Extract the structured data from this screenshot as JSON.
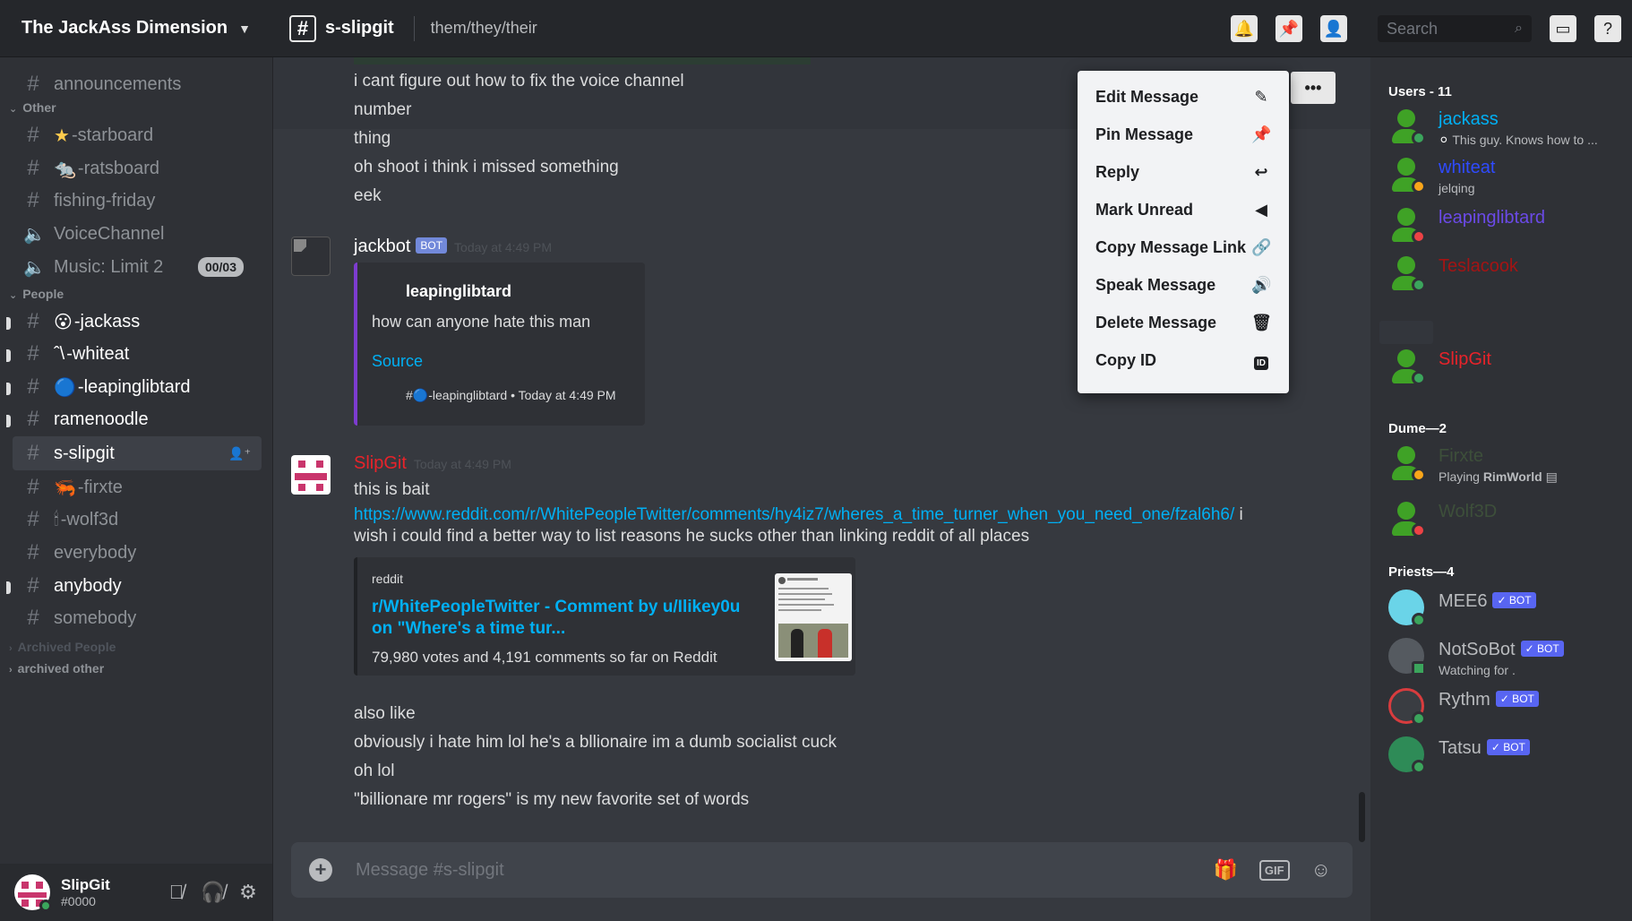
{
  "server": {
    "name": "The JackAss Dimension"
  },
  "channel": {
    "name": "s-slipgit",
    "topic": "them/they/their"
  },
  "search": {
    "placeholder": "Search"
  },
  "colors": {
    "online": "#3ba55c",
    "idle": "#faa61a",
    "dnd": "#ed4245",
    "link": "#00b0f4",
    "bot_tag": "#7289da",
    "embed_border": "#7d3cd0"
  },
  "sidebar": {
    "categories": {
      "other": "Other",
      "people": "People",
      "archived_people": "Archived People",
      "archived_other": "archived other"
    },
    "channels": [
      {
        "label": "announcements"
      },
      {
        "emoji": "★",
        "label": "-starboard"
      },
      {
        "emoji": "🐀",
        "label": "-ratsboard"
      },
      {
        "label": "fishing-friday"
      },
      {
        "label": "VoiceChannel"
      },
      {
        "label": "Music: Limit 2",
        "badge": "00/03"
      },
      {
        "emoji": "😮",
        "label": "-jackass"
      },
      {
        "emoji": "ˆ\\",
        "label": "-whiteat"
      },
      {
        "emoji": "🔵",
        "label": "-leapinglibtard"
      },
      {
        "label": "ramenoodle"
      },
      {
        "label": "s-slipgit"
      },
      {
        "emoji": "🦐",
        "label": "-firxte"
      },
      {
        "emoji": "🕯",
        "label": "-wolf3d"
      },
      {
        "label": "everybody"
      },
      {
        "label": "anybody"
      },
      {
        "label": "somebody"
      }
    ]
  },
  "user_panel": {
    "name": "SlipGit",
    "tag": "#0000"
  },
  "messages": {
    "continuation": [
      "i cant figure out how to fix the voice channel",
      "number",
      "thing",
      "oh shoot i think i missed something",
      "eek"
    ],
    "jackbot": {
      "author": "jackbot",
      "bot_label": "BOT",
      "time": "Today at 4:49 PM",
      "embed": {
        "author": "leapinglibtard",
        "text": "how can anyone hate this man",
        "source_label": "Source",
        "footer_prefix": "#",
        "footer": "-leapinglibtard • Today at 4:49 PM"
      }
    },
    "slipgit": {
      "author": "SlipGit",
      "time": "Today at 4:49 PM",
      "line1": "this is bait",
      "link": "https://www.reddit.com/r/WhitePeopleTwitter/comments/hy4iz7/wheres_a_time_turner_when_you_need_one/fzal6h6/",
      "line2_suffix": " i",
      "line3": "wish i could find a better way to list reasons he sucks other than linking reddit of all places",
      "embed": {
        "provider": "reddit",
        "title": "r/WhitePeopleTwitter - Comment by u/Ilikey0u on \"Where's a time tur...",
        "description": "79,980 votes and 4,191 comments so far on Reddit"
      },
      "after": [
        "also like",
        "obviously i hate him lol he's a bllionaire im a dumb socialist cuck",
        "oh lol",
        "\"billionare mr rogers\" is my new favorite set of words"
      ]
    }
  },
  "composer": {
    "placeholder": "Message #s-slipgit",
    "gif_label": "GIF"
  },
  "context_menu": {
    "items": [
      {
        "label": "Edit Message",
        "icon": "pencil-icon"
      },
      {
        "label": "Pin Message",
        "icon": "pin-icon"
      },
      {
        "label": "Reply",
        "icon": "reply-icon"
      },
      {
        "label": "Mark Unread",
        "icon": "mark-unread-icon"
      },
      {
        "label": "Copy Message Link",
        "icon": "link-icon"
      },
      {
        "label": "Speak Message",
        "icon": "speaker-icon"
      },
      {
        "label": "Delete Message",
        "icon": "trash-icon"
      },
      {
        "label": "Copy ID",
        "icon": "id-icon",
        "icon_text": "ID"
      }
    ]
  },
  "members": {
    "groups": [
      {
        "label": "Users - 11"
      },
      {
        "label": "Dume—2"
      },
      {
        "label": "Priests—4"
      }
    ],
    "list": [
      {
        "name": "jackass",
        "color": "#00b0f4",
        "status_text": "This guy. Knows how to ...",
        "status": "online"
      },
      {
        "name": "whiteat",
        "color": "#2f4bff",
        "status_text": "jelqing",
        "status": "idle"
      },
      {
        "name": "leapinglibtard",
        "color": "#6b4ae8",
        "status": "dnd"
      },
      {
        "name": "Teslacook",
        "color": "#a31414",
        "status": "online"
      },
      {
        "name": "SlipGit",
        "color": "#e8232a",
        "status": "online"
      },
      {
        "name": "Firxte",
        "color": "#3d4f3a",
        "activity_prefix": "Playing ",
        "activity": "RimWorld",
        "status": "idle"
      },
      {
        "name": "Wolf3D",
        "color": "#3d4f3a",
        "status": "dnd"
      },
      {
        "name": "MEE6",
        "color": "#b9bbbe",
        "bot": "✓ BOT",
        "status": "online"
      },
      {
        "name": "NotSoBot",
        "color": "#b9bbbe",
        "bot": "✓ BOT",
        "status_text": "Watching for .",
        "status": "online"
      },
      {
        "name": "Rythm",
        "color": "#b9bbbe",
        "bot": "✓ BOT",
        "status": "online"
      },
      {
        "name": "Tatsu",
        "color": "#b9bbbe",
        "bot": "✓ BOT",
        "status": "online"
      }
    ]
  }
}
